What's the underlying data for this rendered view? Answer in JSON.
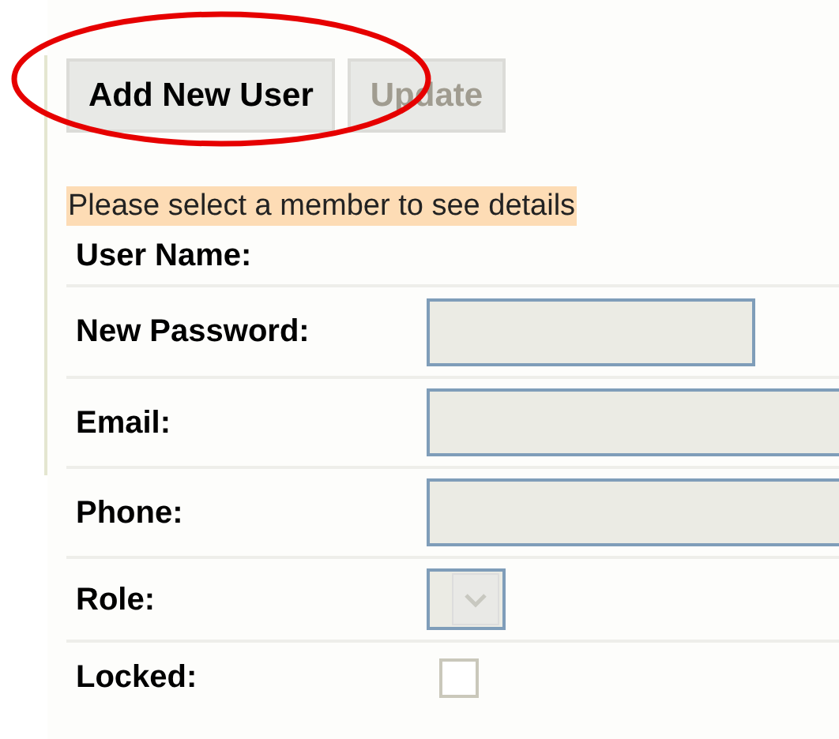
{
  "toolbar": {
    "buttons": [
      {
        "label": "Add New User",
        "disabled": false
      },
      {
        "label": "Update",
        "disabled": true
      }
    ]
  },
  "message": "Please select a member to see details",
  "form": {
    "rows": [
      {
        "label": "User Name:",
        "kind": "none"
      },
      {
        "label": "New Password:",
        "kind": "text",
        "disabled": true
      },
      {
        "label": "Email:",
        "kind": "text",
        "disabled": true
      },
      {
        "label": "Phone:",
        "kind": "text",
        "disabled": true
      },
      {
        "label": "Role:",
        "kind": "select",
        "disabled": true
      },
      {
        "label": "Locked:",
        "kind": "checkbox",
        "checked": false,
        "disabled": true
      }
    ]
  }
}
